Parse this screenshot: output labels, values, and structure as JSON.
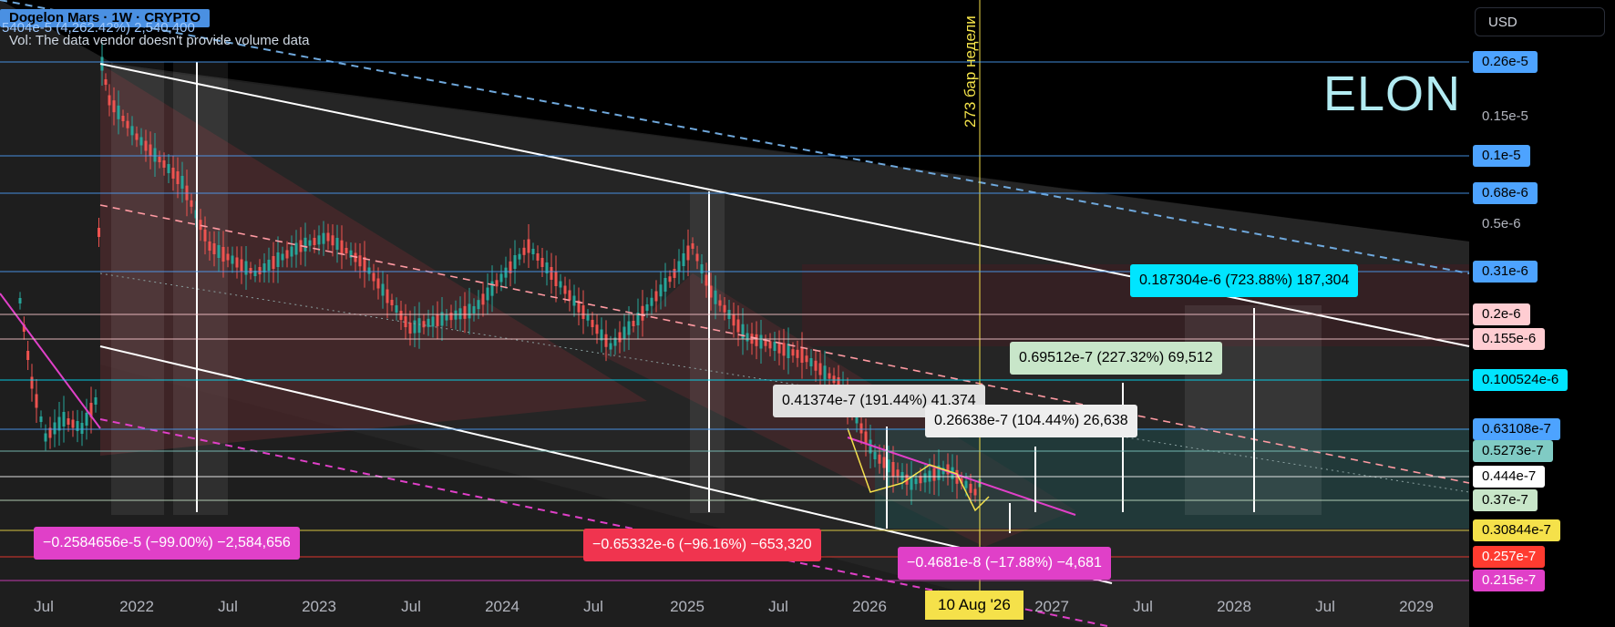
{
  "header": {
    "title": "Dogelon Mars · 1W · CRYPTO",
    "price_line": "5404e-5 (4,262.42%) 2,540,400",
    "volume_note": "Vol: The data vendor doesn't provide volume data"
  },
  "currency_button": "USD",
  "watermark": "ELON",
  "vertical_marker": {
    "label": "273 бар недели",
    "date_chip": "10 Aug '26"
  },
  "chart_data": {
    "type": "candlestick",
    "symbol": "ELON",
    "timeframe": "1W",
    "x_ticks": [
      "Jul",
      "2022",
      "Jul",
      "2023",
      "Jul",
      "2024",
      "Jul",
      "2025",
      "Jul",
      "2026",
      "Jul",
      "2027",
      "Jul",
      "2028",
      "Jul",
      "2029"
    ],
    "y_scale": "log",
    "price_axis_labels": [
      {
        "text": "0.26e-5",
        "style": "highlight"
      },
      {
        "text": "0.15e-5",
        "style": "plain"
      },
      {
        "text": "0.1e-5",
        "style": "highlight"
      },
      {
        "text": "0.68e-6",
        "style": "highlight"
      },
      {
        "text": "0.5e-6",
        "style": "plain"
      },
      {
        "text": "0.31e-6",
        "style": "highlight"
      },
      {
        "text": "0.2e-6",
        "style": "pink"
      },
      {
        "text": "0.155e-6",
        "style": "pink"
      },
      {
        "text": "0.100524e-6",
        "style": "cyan"
      },
      {
        "text": "0.63108e-7",
        "style": "highlight"
      },
      {
        "text": "0.5273e-7",
        "style": "teal"
      },
      {
        "text": "0.444e-7",
        "style": "white"
      },
      {
        "text": "0.37e-7",
        "style": "green"
      },
      {
        "text": "0.30844e-7",
        "style": "yellow"
      },
      {
        "text": "0.257e-7",
        "style": "red"
      },
      {
        "text": "0.215e-7",
        "style": "magenta"
      }
    ],
    "measurements": [
      {
        "text": "−0.2584656e-5 (−99.00%) −2,584,656",
        "color": "#e040c8"
      },
      {
        "text": "−0.65332e-6 (−96.16%) −653,320",
        "color": "#f0344f"
      },
      {
        "text": "−0.4681e-8 (−17.88%) −4,681",
        "color": "#e040c8"
      },
      {
        "text": "0.187304e-6 (723.88%) 187,304",
        "color": "#00e5ff"
      },
      {
        "text": "0.69512e-7 (227.32%) 69,512",
        "color": "#c8e6c9"
      },
      {
        "text": "0.41374e-7 (191.44%) 41,374",
        "color": "#e0e0e0"
      },
      {
        "text": "0.26638e-7 (104.44%) 26,638",
        "color": "#eeeeee"
      }
    ],
    "colors": {
      "up": "#26a69a",
      "down": "#ef5350",
      "channel": "#ffffff",
      "highlight": "#4da3ff"
    }
  }
}
